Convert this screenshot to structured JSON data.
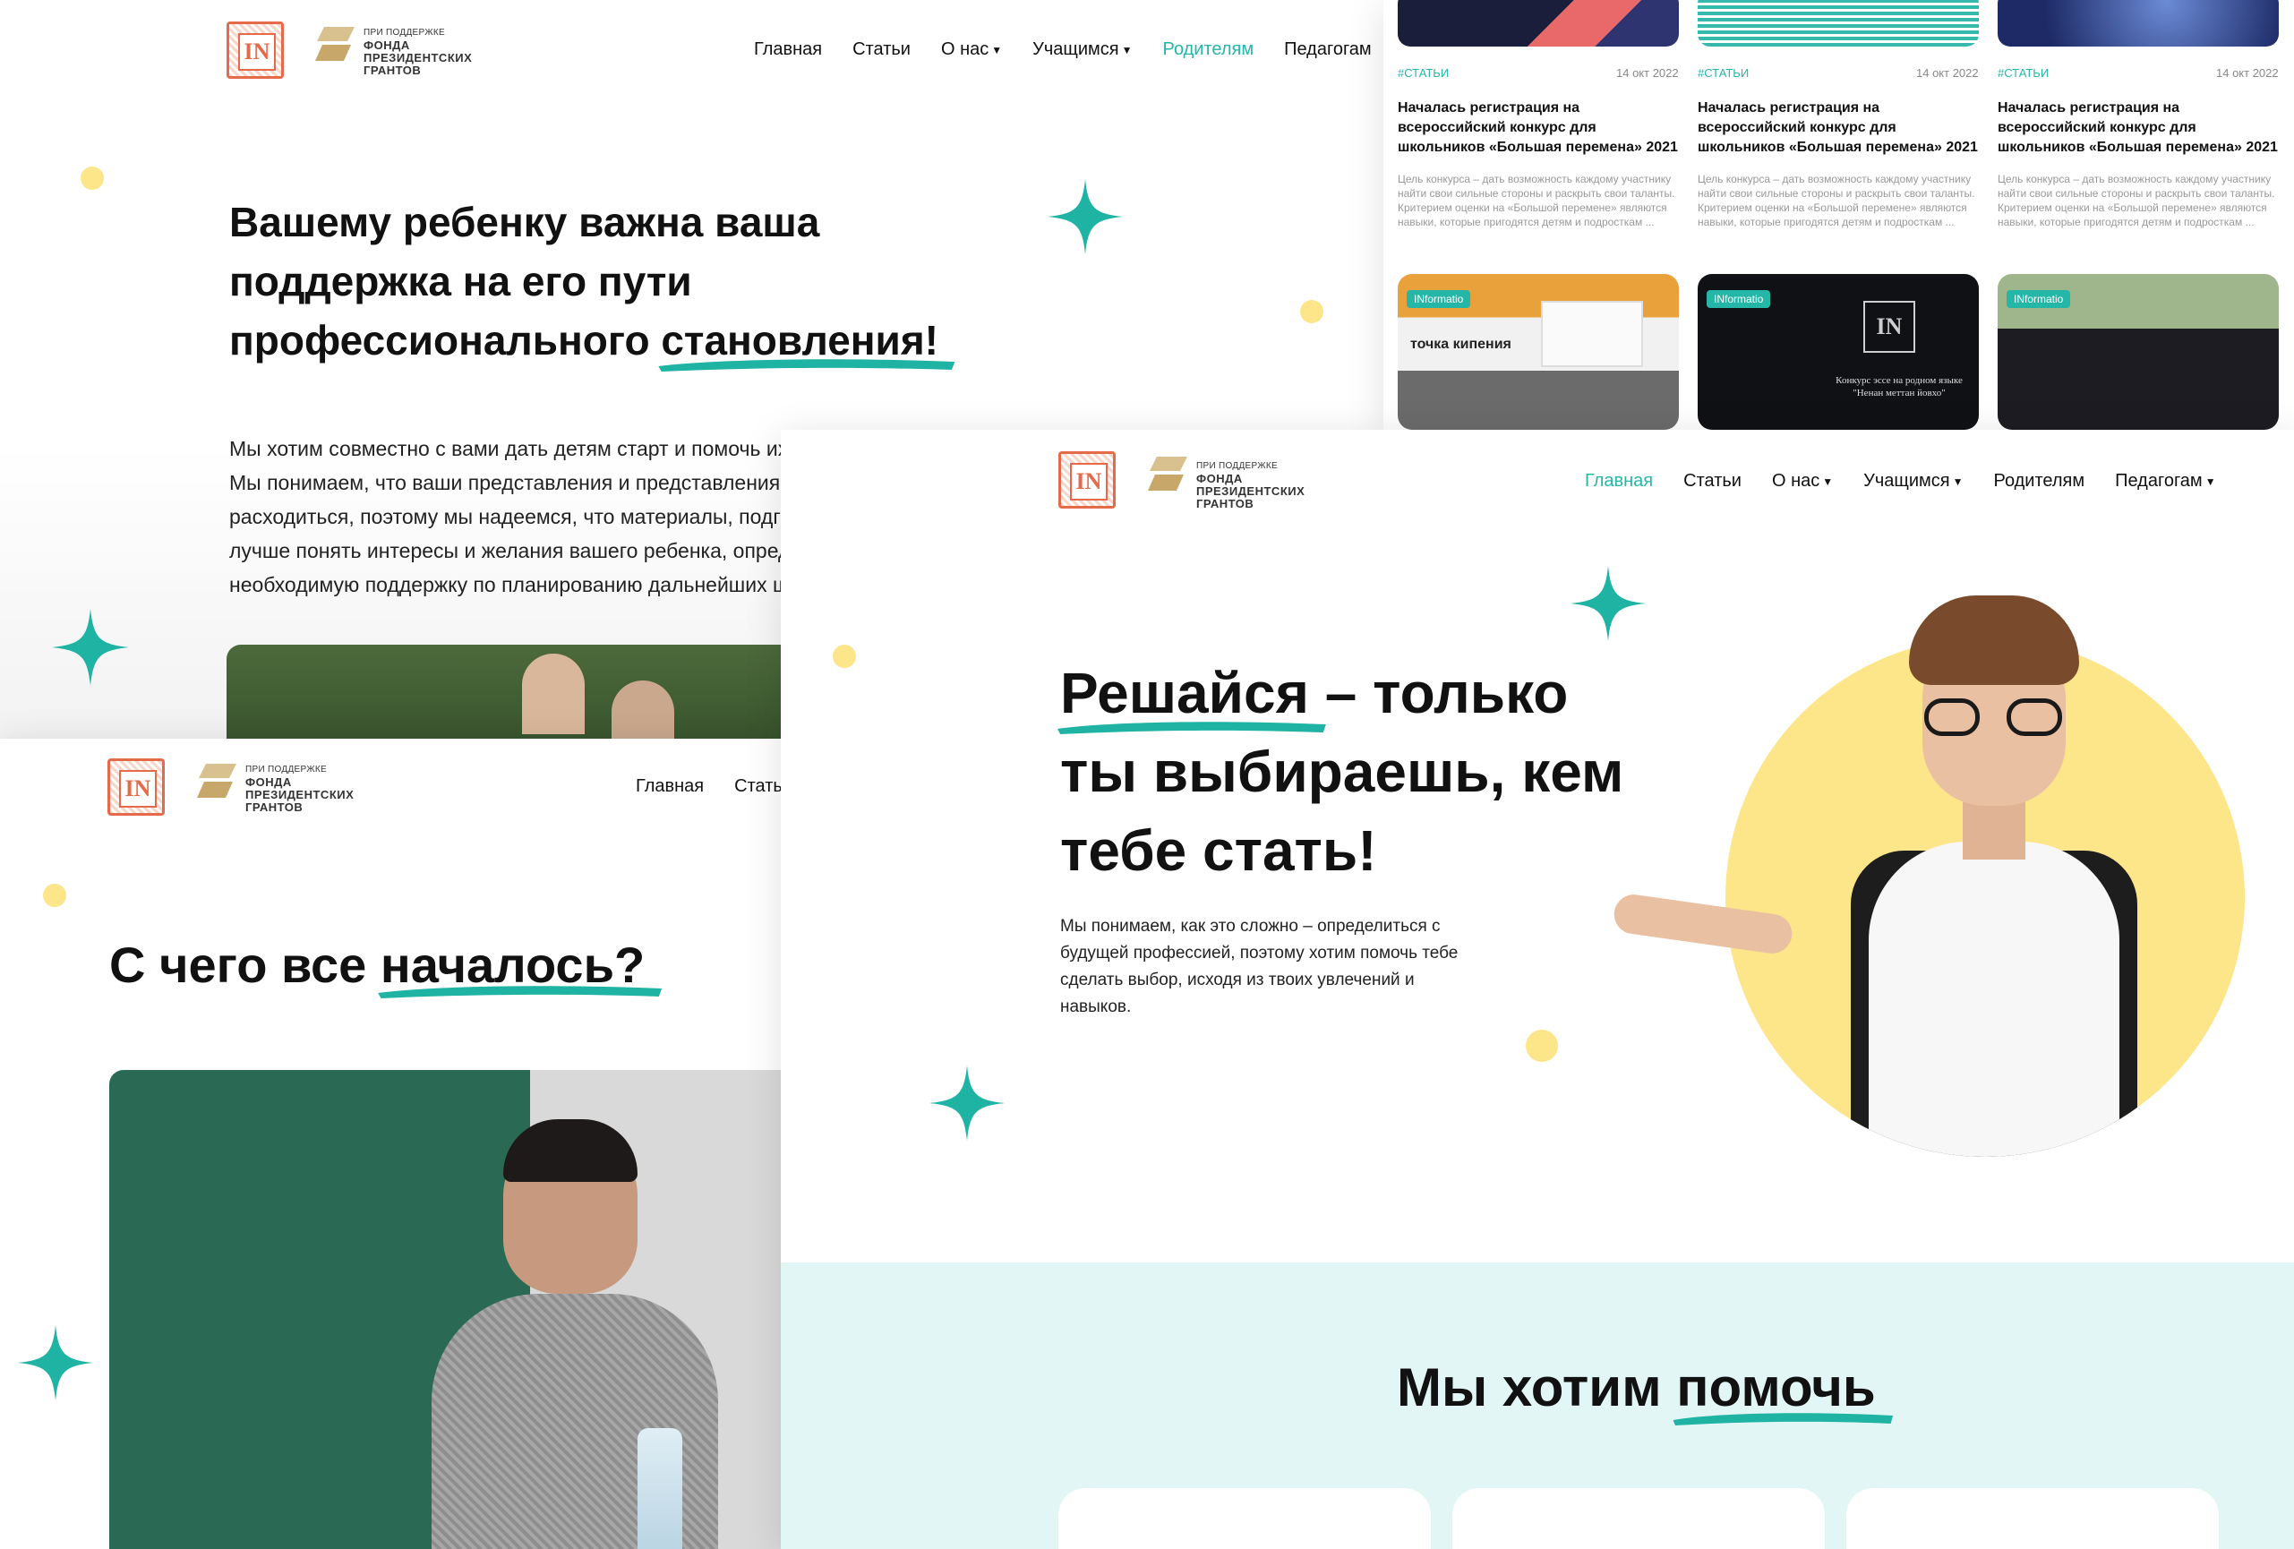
{
  "brand": {
    "logo_text": "IN",
    "grant_small": "ПРИ ПОДДЕРЖКЕ",
    "grant_line1": "ФОНДА",
    "grant_line2": "ПРЕЗИДЕНТСКИХ",
    "grant_line3": "ГРАНТОВ"
  },
  "nav": {
    "home": "Главная",
    "articles": "Статьи",
    "about": "О нас",
    "students": "Учащимся",
    "parents": "Родителям",
    "teachers": "Педагогам"
  },
  "parents_page": {
    "heading_start": "Вашему ребенку важна ваша поддержка на его пути профессионального",
    "heading_marked": "становления!",
    "paragraph": "Мы хотим совместно с вами дать детям старт и помочь их профессиональному самоопределению. Мы понимаем, что ваши представления и представления детей о будущей профессии могут расходиться, поэтому мы надеемся, что материалы, подготовленные нашей командой, помогут вам лучше понять интересы и желания вашего ребенка, определить его навыки, потенциал и оказать ему необходимую поддержку по планированию дальнейших шагов."
  },
  "about_page": {
    "heading_start": "С чего все",
    "heading_marked": "началось?"
  },
  "news": {
    "items": [
      {
        "tag": "#СТАТЬИ",
        "date": "14 окт 2022",
        "title": "Началась регистрация на всероссийский конкурс для школьников «Большая перемена» 2021",
        "text": "Цель конкурса – дать возможность каждому участнику найти свои сильные стороны и раскрыть свои таланты. Критерием оценки на «Большой перемене» являются навыки, которые пригодятся детям и подросткам ..."
      },
      {
        "tag": "#СТАТЬИ",
        "date": "14 окт 2022",
        "title": "Началась регистрация на всероссийский конкурс для школьников «Большая перемена» 2021",
        "text": "Цель конкурса – дать возможность каждому участнику найти свои сильные стороны и раскрыть свои таланты. Критерием оценки на «Большой перемене» являются навыки, которые пригодятся детям и подросткам ..."
      },
      {
        "tag": "#СТАТЬИ",
        "date": "14 окт 2022",
        "title": "Началась регистрация на всероссийский конкурс для школьников «Большая перемена» 2021",
        "text": "Цель конкурса – дать возможность каждому участнику найти свои сильные стороны и раскрыть свои таланты. Критерием оценки на «Большой перемене» являются навыки, которые пригодятся детям и подросткам ..."
      }
    ],
    "photo_badge": "INformatio",
    "photo2_caption_line1": "Конкурс эссе на родном языке",
    "photo2_caption_line2": "\"Ненан меттан йовхо\"",
    "photo1_caption": "точка кипения"
  },
  "home_page": {
    "heading_marked": "Решайся",
    "heading_rest": " – только ты выбираешь, кем тебе стать!",
    "paragraph": "Мы понимаем, как это сложно – определиться с будущей профессией, поэтому хотим помочь тебе сделать выбор, исходя из твоих увлечений и навыков.",
    "section_title_start": "Мы хотим",
    "section_title_marked": "помочь"
  },
  "colors": {
    "accent": "#24b7a8",
    "dot_yellow": "#fde58a",
    "mint_bg": "#e2f7f5",
    "logo_red": "#e46a4a",
    "grant_gold": "#c8a86a"
  }
}
